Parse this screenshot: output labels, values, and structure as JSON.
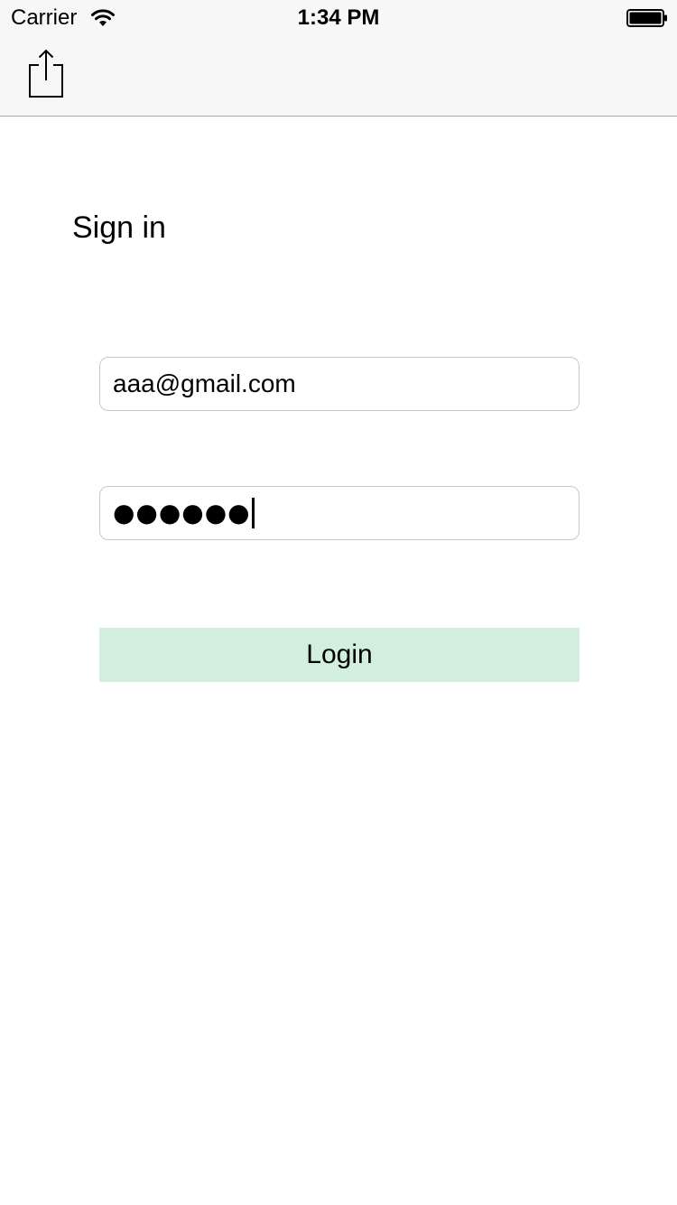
{
  "status_bar": {
    "carrier": "Carrier",
    "time": "1:34 PM",
    "wifi_icon": "wifi-icon",
    "battery_icon": "battery-full-icon"
  },
  "nav_bar": {
    "share_icon": "share-icon"
  },
  "main": {
    "title": "Sign in",
    "email_value": "aaa@gmail.com",
    "password_masked": "●●●●●●",
    "login_label": "Login"
  },
  "colors": {
    "bar_background": "#f7f7f7",
    "login_button_background": "#d2efdd",
    "field_border": "#c8c8cc"
  }
}
